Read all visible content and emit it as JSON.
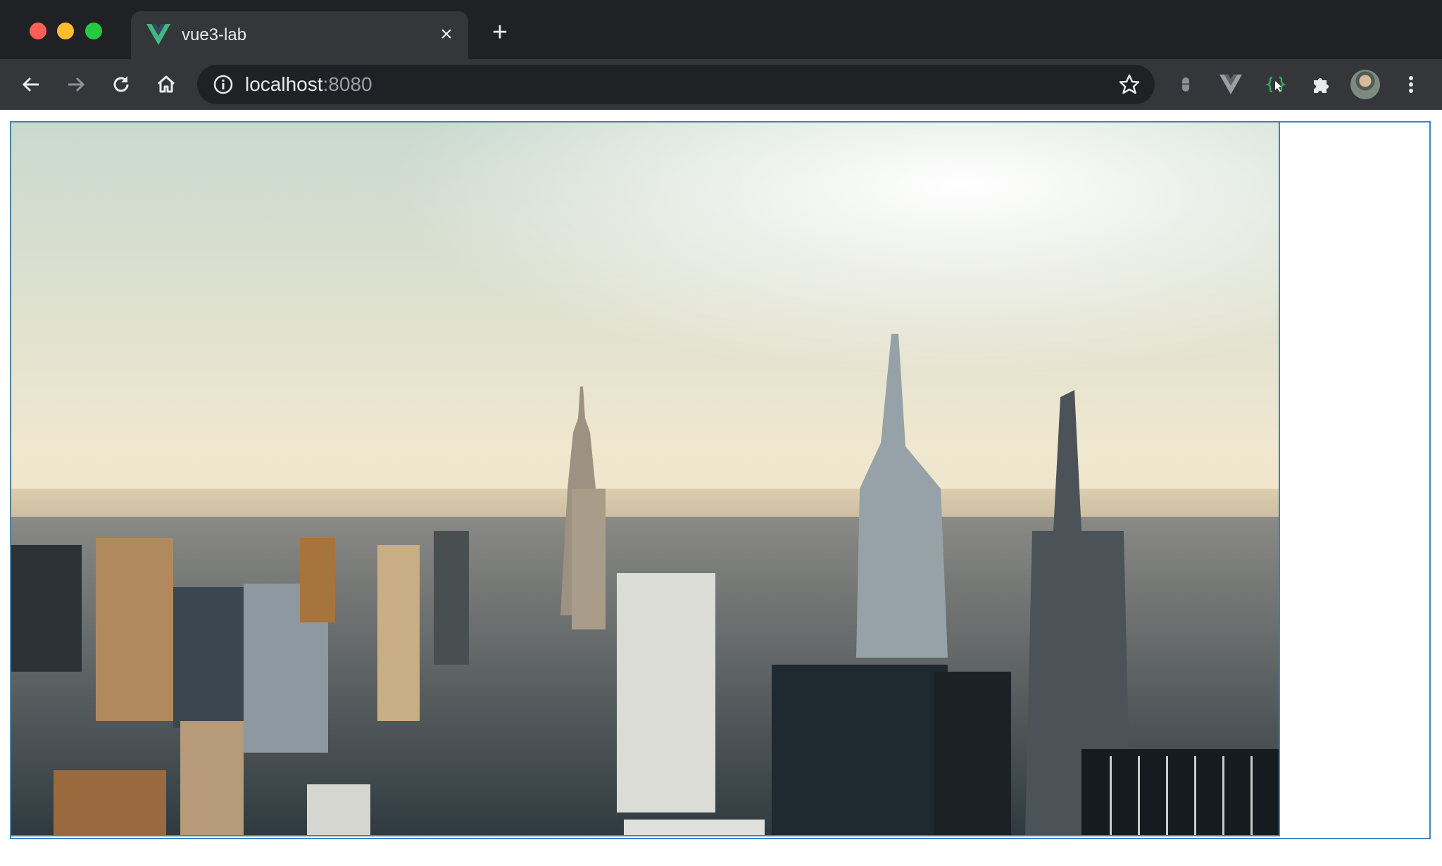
{
  "browser": {
    "tab": {
      "title": "vue3-lab",
      "favicon": "vue-logo-icon"
    },
    "address": {
      "host": "localhost",
      "port": ":8080"
    },
    "toolbar_icons": [
      "back-arrow-icon",
      "forward-arrow-icon",
      "reload-icon",
      "home-icon",
      "info-icon",
      "star-icon",
      "extension-icon",
      "vue-devtools-icon",
      "dev-extension-icon",
      "puzzle-icon",
      "avatar",
      "kebab-menu-icon"
    ]
  },
  "page": {
    "image": "city-skyline-photo"
  },
  "colors": {
    "tab_bar": "#202124",
    "toolbar": "#35363a",
    "outer_frame_border": "#3d83c9",
    "image_border": "#4a8597"
  }
}
